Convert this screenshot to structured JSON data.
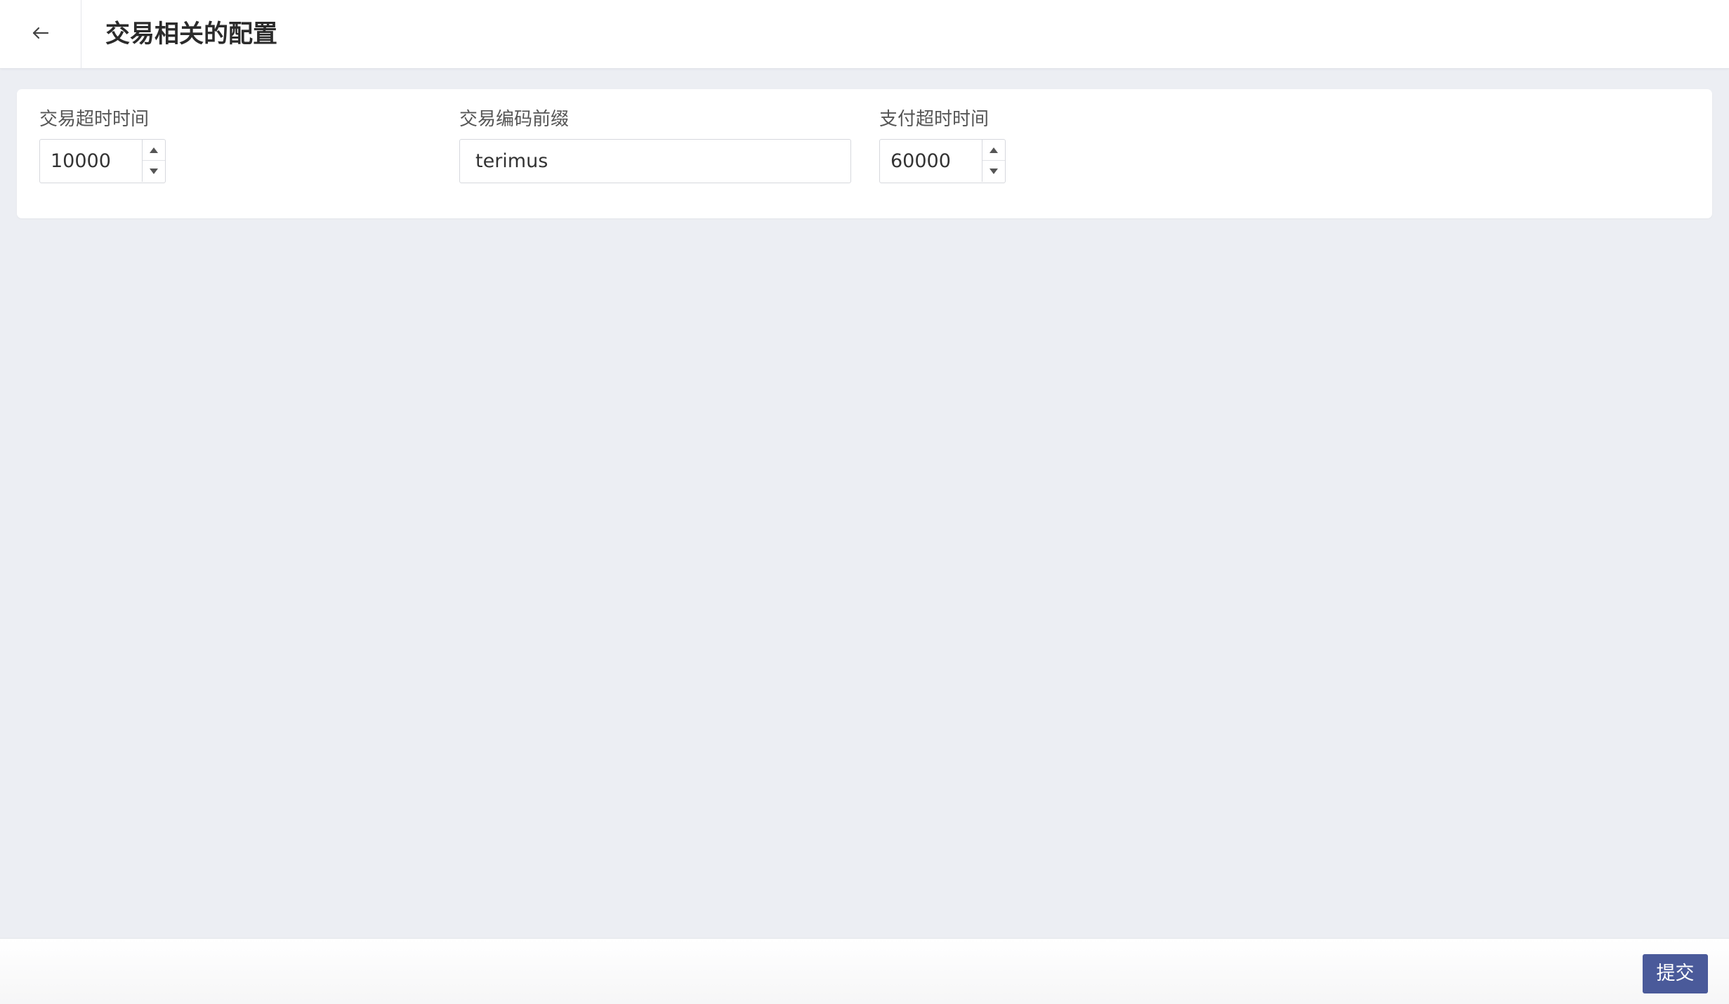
{
  "header": {
    "back_icon": "arrow-left-icon",
    "title": "交易相关的配置"
  },
  "form": {
    "trade_timeout": {
      "label": "交易超时时间",
      "value": "10000"
    },
    "trade_code_prefix": {
      "label": "交易编码前缀",
      "value": "terimus"
    },
    "payment_timeout": {
      "label": "支付超时时间",
      "value": "60000"
    }
  },
  "footer": {
    "submit_label": "提交"
  },
  "colors": {
    "background": "#eceef3",
    "card": "#ffffff",
    "primary_button": "#4a5a9a"
  }
}
